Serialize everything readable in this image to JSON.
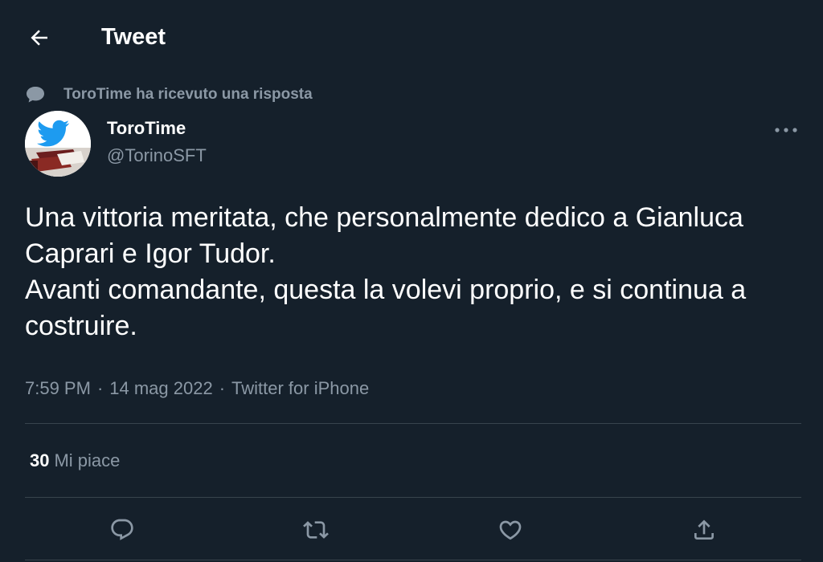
{
  "header": {
    "title": "Tweet",
    "back_icon": "arrow-left-icon"
  },
  "context": {
    "icon": "speech-bubble-icon",
    "text": "ToroTime ha ricevuto una risposta"
  },
  "author": {
    "display_name": "ToroTime",
    "handle": "@TorinoSFT",
    "avatar": "twitter-bird-avatar"
  },
  "tweet": {
    "paragraphs": [
      "Una vittoria meritata, che personalmente dedico a Gianluca Caprari e Igor Tudor.",
      "Avanti comandante, questa la volevi proprio, e si continua a costruire."
    ]
  },
  "meta": {
    "time": "7:59 PM",
    "date": "14 mag 2022",
    "source": "Twitter for iPhone",
    "separator": "·"
  },
  "stats": {
    "likes_count": "30",
    "likes_label": "Mi piace"
  },
  "actions": {
    "reply_icon": "reply-icon",
    "retweet_icon": "retweet-icon",
    "like_icon": "heart-icon",
    "share_icon": "share-icon"
  },
  "colors": {
    "background": "#15202b",
    "text_primary": "#ffffff",
    "text_secondary": "#8b98a5",
    "divider": "#38444d",
    "twitter_blue": "#1d9bf0"
  }
}
